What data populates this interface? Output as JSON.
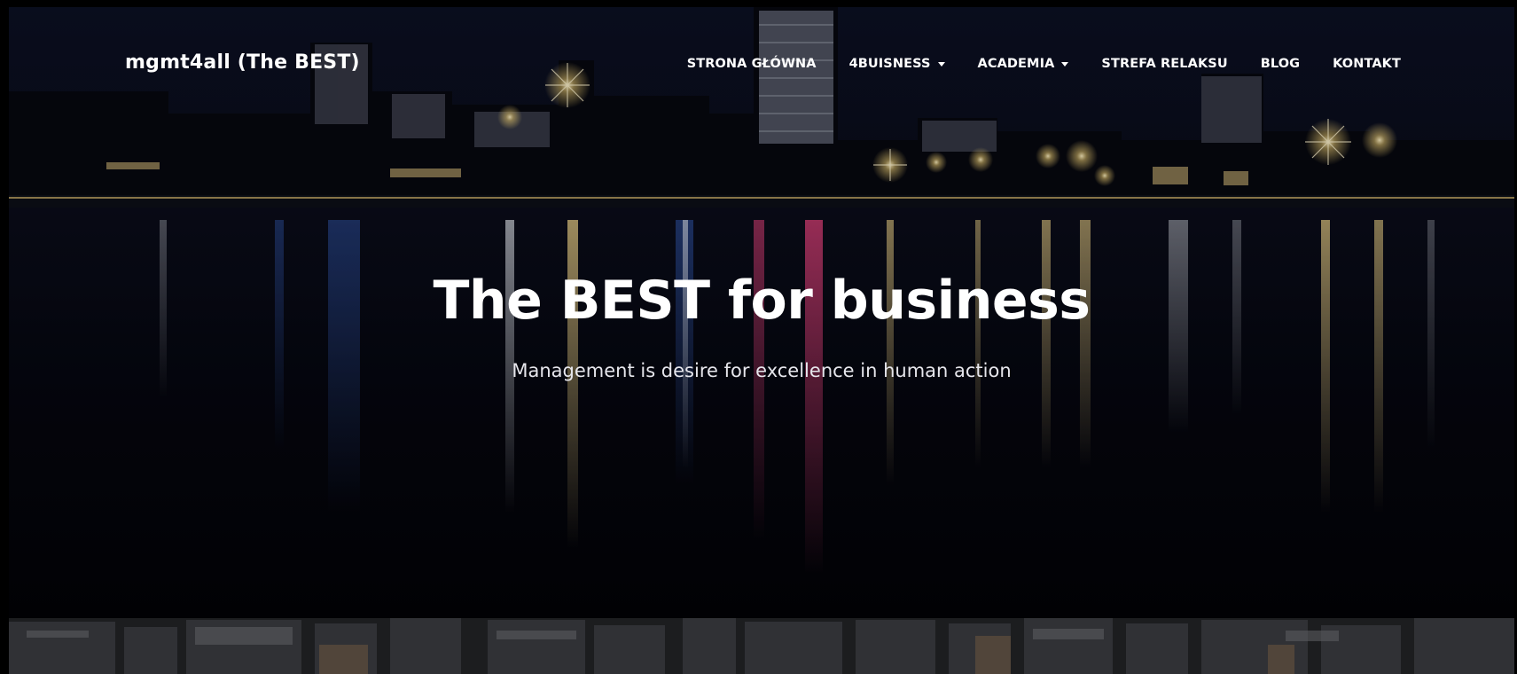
{
  "brand": {
    "name": "mgmt4all (The BEST)"
  },
  "nav": {
    "items": [
      {
        "label": "STRONA GŁÓWNA",
        "dropdown": false
      },
      {
        "label": "4BUISNESS",
        "dropdown": true
      },
      {
        "label": "ACADEMIA",
        "dropdown": true
      },
      {
        "label": "STREFA RELAKSU",
        "dropdown": false
      },
      {
        "label": "BLOG",
        "dropdown": false
      },
      {
        "label": "KONTAKT",
        "dropdown": false
      }
    ]
  },
  "hero": {
    "title": "The BEST for business",
    "subtitle": "Management is desire for excellence in human action"
  },
  "colors": {
    "text": "#ffffff",
    "background": "#05060c",
    "accent_light": "#f4d58a"
  },
  "icons": {
    "dropdown": "caret-down-icon"
  }
}
